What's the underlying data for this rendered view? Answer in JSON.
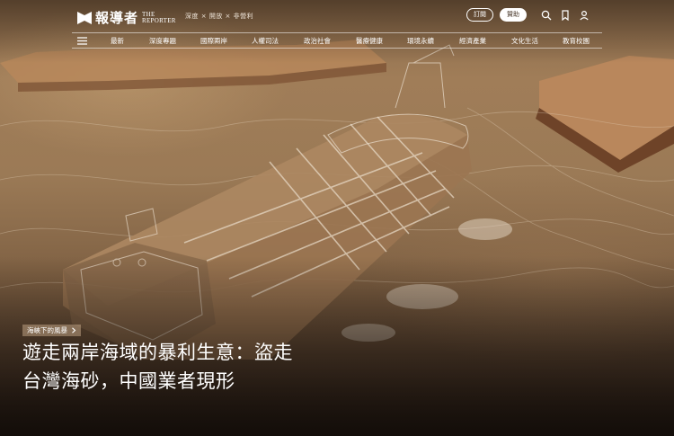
{
  "brand": {
    "name_cn": "報導者",
    "name_en_line1": "THE",
    "name_en_line2": "REPORTER",
    "tagline": "深度 × 開放 × 非營利"
  },
  "header_actions": {
    "subscribe_label": "訂閱",
    "donate_label": "贊助",
    "icons": [
      "search-icon",
      "bookmark-icon",
      "user-icon"
    ]
  },
  "nav": {
    "menu_icon": "hamburger-menu-icon",
    "items": [
      {
        "label": "最新"
      },
      {
        "label": "深度專題"
      },
      {
        "label": "國際兩岸"
      },
      {
        "label": "人權司法"
      },
      {
        "label": "政治社會"
      },
      {
        "label": "醫療健康"
      },
      {
        "label": "環境永續"
      },
      {
        "label": "經濟產業"
      },
      {
        "label": "文化生活"
      },
      {
        "label": "教育校園"
      }
    ]
  },
  "feature": {
    "category_label": "海峽下的風暴",
    "headline_line1": "遊走兩岸海域的暴利生意：盜走",
    "headline_line2": "台灣海砂，中國業者現形"
  },
  "colors": {
    "text": "#ffffff",
    "donate_text": "#4a3a2c",
    "sand": "#9b7a56"
  }
}
